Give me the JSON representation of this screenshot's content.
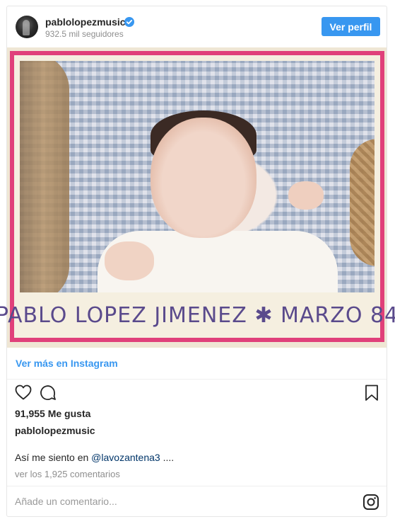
{
  "header": {
    "username": "pablolopezmusic",
    "followers": "932.5 mil seguidores",
    "follow_button": "Ver perfil",
    "verified_icon": "verified-badge-icon"
  },
  "photo": {
    "caption_text": "PABLO LOPEZ JIMENEZ ✱ MARZO 84",
    "frame_color": "#e0407a"
  },
  "link": {
    "label": "Ver más en Instagram"
  },
  "actions": {
    "like_icon": "heart-icon",
    "comment_icon": "comment-icon",
    "save_icon": "bookmark-icon"
  },
  "likes": "91,955 Me gusta",
  "owner": "pablolopezmusic",
  "caption": {
    "text": "Así me siento en ",
    "mention": "@lavozantena3",
    "ellipsis": " ...."
  },
  "comments_link": "ver los 1,925 comentarios",
  "add_comment": {
    "placeholder": "Añade un comentario...",
    "icon": "instagram-logo-icon"
  },
  "colors": {
    "accent": "#3897f0",
    "mention": "#003569",
    "muted": "#8e8e8e"
  }
}
